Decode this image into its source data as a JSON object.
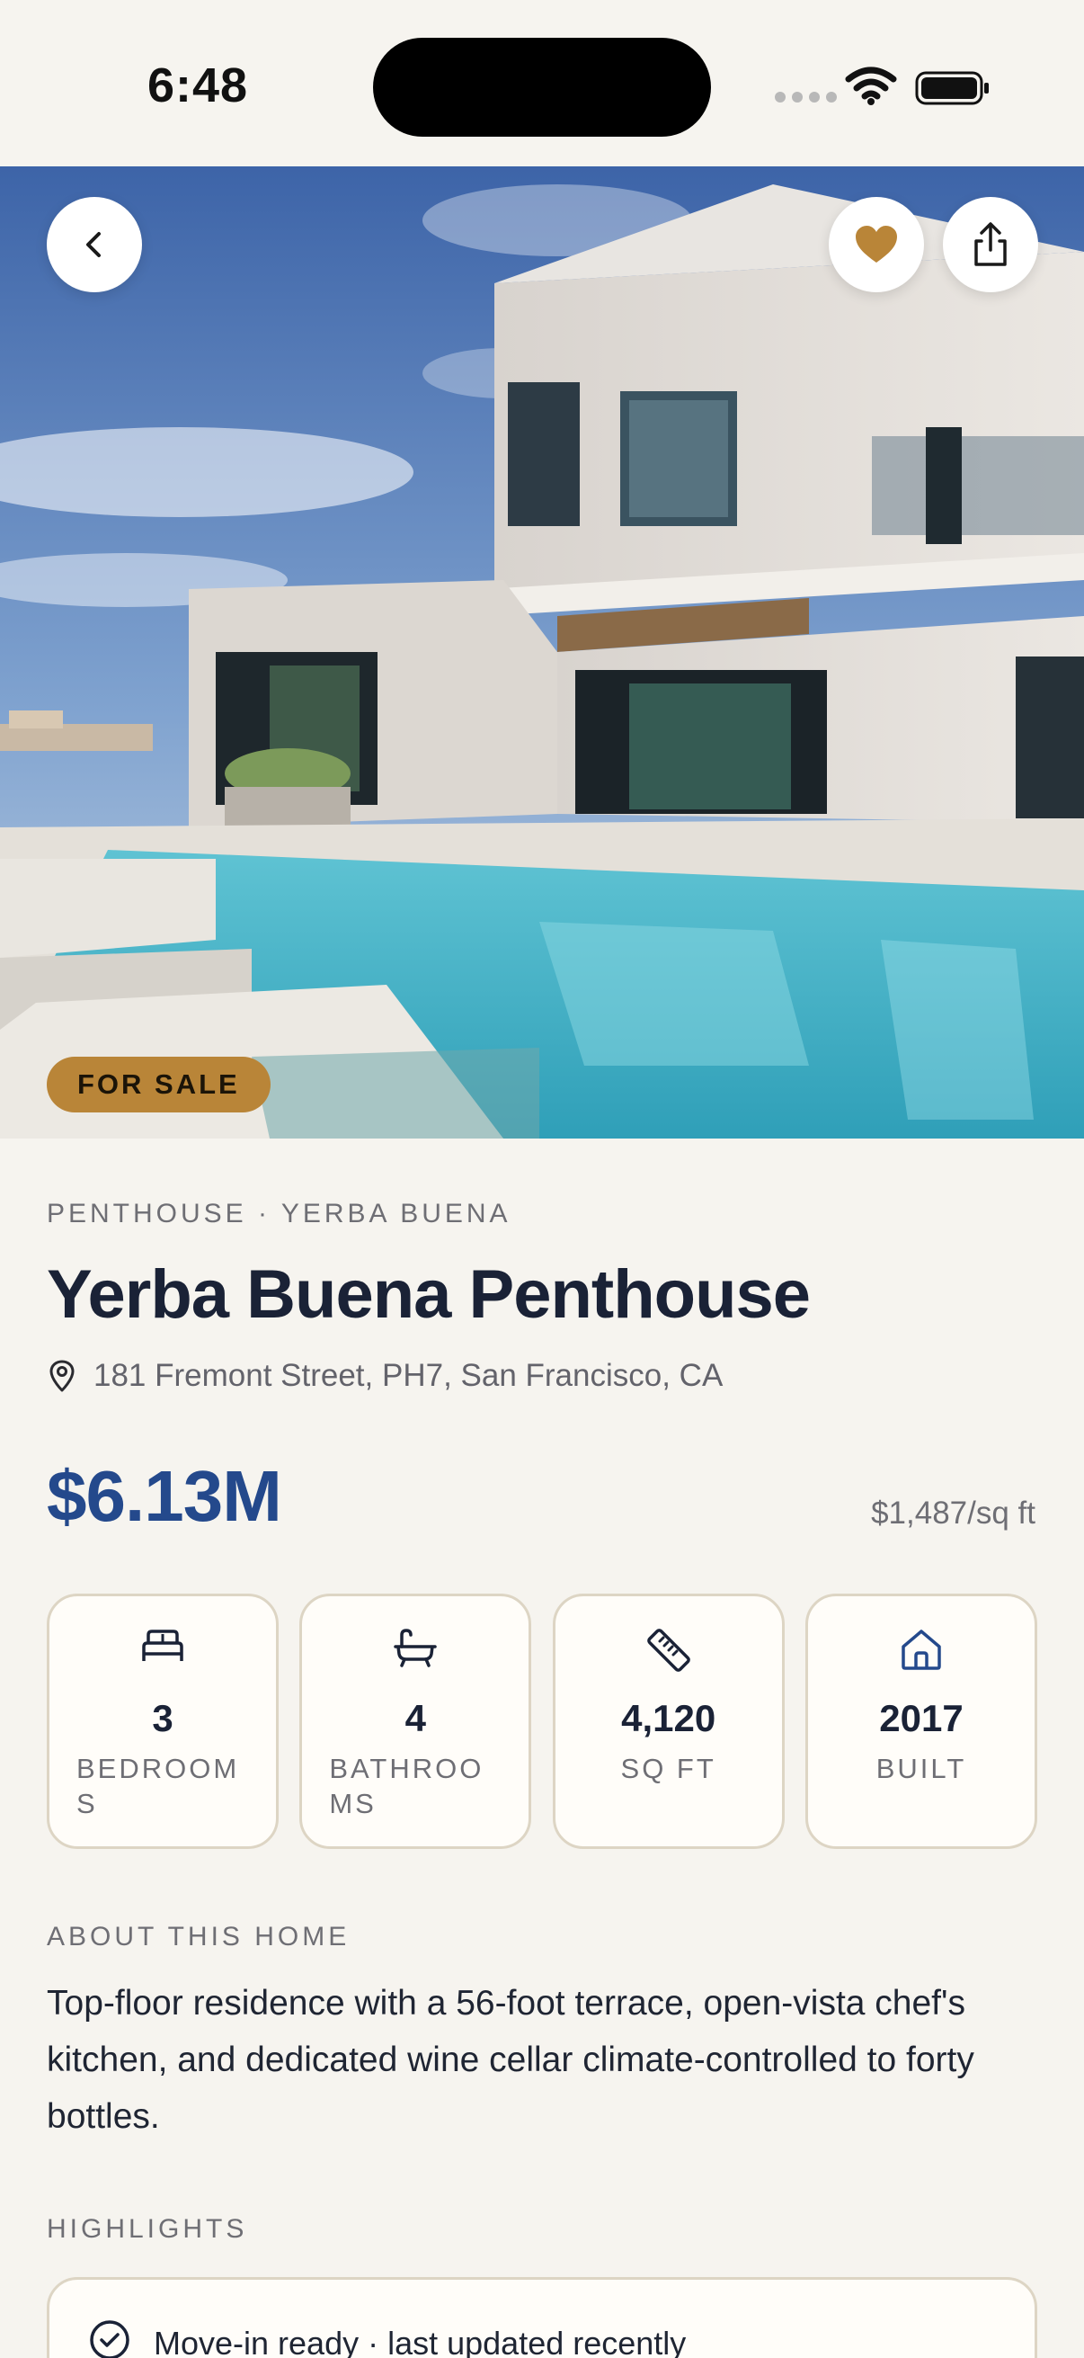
{
  "status": {
    "time": "6:48"
  },
  "hero": {
    "badge": "FOR SALE",
    "favorited": true
  },
  "listing": {
    "eyebrow": "PENTHOUSE · YERBA BUENA",
    "title": "Yerba Buena Penthouse",
    "address": "181 Fremont Street, PH7, San Francisco, CA",
    "price": "$6.13M",
    "price_per_sqft": "$1,487/sq ft"
  },
  "stats": [
    {
      "icon": "bed-icon",
      "value": "3",
      "label": "BEDROOMS"
    },
    {
      "icon": "bathtub-icon",
      "value": "4",
      "label": "BATHROOMS"
    },
    {
      "icon": "ruler-icon",
      "value": "4,120",
      "label": "SQ FT"
    },
    {
      "icon": "home-icon",
      "value": "2017",
      "label": "BUILT"
    }
  ],
  "about": {
    "heading": "ABOUT THIS HOME",
    "text": "Top-floor residence with a 56-foot terrace, open-vista chef's kitchen, and dedicated wine cellar climate-controlled to forty bottles."
  },
  "highlights": {
    "heading": "HIGHLIGHTS",
    "items": [
      "Move-in ready · last updated recently"
    ]
  },
  "colors": {
    "accent_gold": "#b98538",
    "price_blue": "#24498c",
    "background": "#f6f4ef",
    "card_border": "#ddd5c4"
  }
}
